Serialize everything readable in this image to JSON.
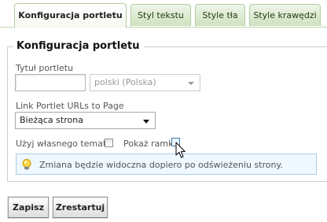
{
  "tabs": [
    {
      "label": "Konfiguracja portletu",
      "active": true
    },
    {
      "label": "Styl tekstu",
      "active": false
    },
    {
      "label": "Style tła",
      "active": false
    },
    {
      "label": "Style krawędzi",
      "active": false
    }
  ],
  "section": {
    "legend": "Konfiguracja portletu"
  },
  "form": {
    "title_label": "Tytuł portletu",
    "title_value": "",
    "language_value": "polski (Polska)",
    "link_label": "Link Portlet URLs to Page",
    "link_value": "Bieżąca strona",
    "own_theme_label": "Użyj własnego tematu",
    "own_theme_checked": false,
    "show_borders_label": "Pokaż ramki",
    "show_borders_checked": false
  },
  "info": {
    "message": "Zmiana będzie widoczna dopiero po odświeżeniu strony.",
    "icon": "lightbulb-icon"
  },
  "buttons": {
    "save_label": "Zapisz",
    "reset_label": "Zrestartuj"
  },
  "colors": {
    "tab_border": "#b3cc9e",
    "tab_gradient_top": "#eef5e8",
    "tab_gradient_bottom": "#cfe2bf",
    "info_background": "#eef8fe",
    "info_border": "#a9cfe6"
  }
}
